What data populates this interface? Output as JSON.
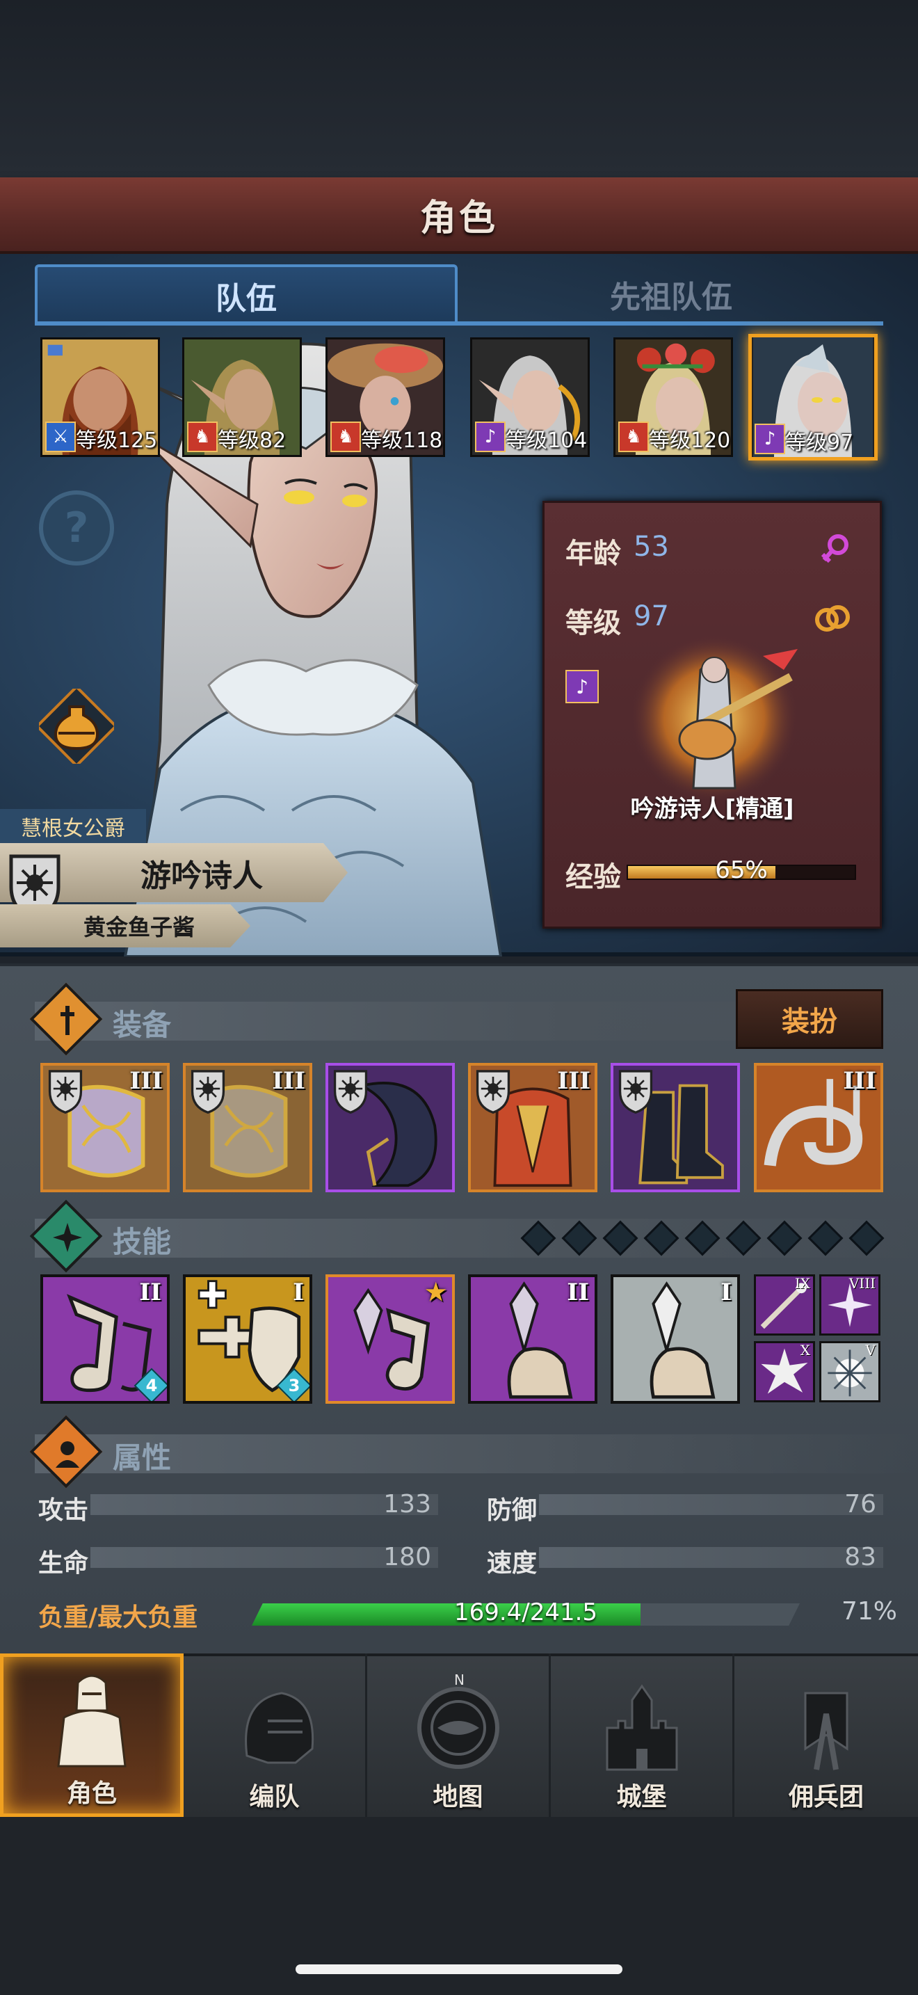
{
  "screen_title": "角色",
  "tabs": {
    "team": "队伍",
    "ancestor_team": "先祖队伍"
  },
  "roster": [
    {
      "level_text": "等级125",
      "class_color": "#2d66c8",
      "class_icon": "sword-icon"
    },
    {
      "level_text": "等级82",
      "class_color": "#c8382a",
      "class_icon": "wolf-icon"
    },
    {
      "level_text": "等级118",
      "class_color": "#c8382a",
      "class_icon": "wolf-icon"
    },
    {
      "level_text": "等级104",
      "class_color": "#7e3ab4",
      "class_icon": "lute-icon"
    },
    {
      "level_text": "等级120",
      "class_color": "#c8382a",
      "class_icon": "wolf-icon"
    },
    {
      "level_text": "等级97",
      "class_color": "#7e3ab4",
      "class_icon": "lute-icon",
      "selected": true
    }
  ],
  "hero": {
    "title_tag": "慧根女公爵",
    "class_name": "游吟诗人",
    "player_name": "黄金鱼子酱"
  },
  "stats_card": {
    "age_label": "年龄",
    "age_value": "53",
    "level_label": "等级",
    "level_value": "97",
    "job_name": "吟游诗人[精通]",
    "exp_label": "经验",
    "exp_text": "65%",
    "exp_fraction": 0.65
  },
  "equipment": {
    "title": "装备",
    "dress_button": "装扮",
    "items": [
      {
        "tier": "III",
        "rarity": "orange",
        "icon": "ornate-shield-icon"
      },
      {
        "tier": "III",
        "rarity": "orange",
        "icon": "ornate-shield-icon"
      },
      {
        "tier": "",
        "rarity": "purple",
        "icon": "hood-icon"
      },
      {
        "tier": "III",
        "rarity": "orange",
        "icon": "armor-icon"
      },
      {
        "tier": "",
        "rarity": "purple",
        "icon": "boots-icon"
      },
      {
        "tier": "III",
        "rarity": "orange",
        "icon": "horn-icon"
      }
    ]
  },
  "skills": {
    "title": "技能",
    "items": [
      {
        "tier": "II",
        "badge": "4",
        "color": "purple",
        "icon": "music-note-icon"
      },
      {
        "tier": "I",
        "badge": "3",
        "color": "gold",
        "icon": "heal-shield-icon"
      },
      {
        "tier": "★",
        "badge": "",
        "color": "purple",
        "icon": "crystal-note-icon"
      },
      {
        "tier": "II",
        "badge": "",
        "color": "purple",
        "icon": "crystal-hand-icon"
      },
      {
        "tier": "I",
        "badge": "",
        "color": "silver",
        "icon": "crystal-hand-icon"
      }
    ],
    "mini": [
      {
        "tier": "IX",
        "color": "purple",
        "icon": "wand-icon"
      },
      {
        "tier": "VIII",
        "color": "purple",
        "icon": "sparkle-icon"
      },
      {
        "tier": "X",
        "color": "purple",
        "icon": "burst-icon"
      },
      {
        "tier": "V",
        "color": "silver",
        "icon": "frost-burst-icon"
      }
    ]
  },
  "attributes": {
    "title": "属性",
    "attack_label": "攻击",
    "attack_value": "133",
    "defense_label": "防御",
    "defense_value": "76",
    "hp_label": "生命",
    "hp_value": "180",
    "speed_label": "速度",
    "speed_value": "83",
    "load_label": "负重/最大负重",
    "load_text": "169.4/241.5",
    "load_percent": "71%",
    "load_fraction": 0.71
  },
  "nav": {
    "character": "角色",
    "formation": "编队",
    "map": "地图",
    "castle": "城堡",
    "mercenary": "佣兵团",
    "map_north": "N"
  }
}
